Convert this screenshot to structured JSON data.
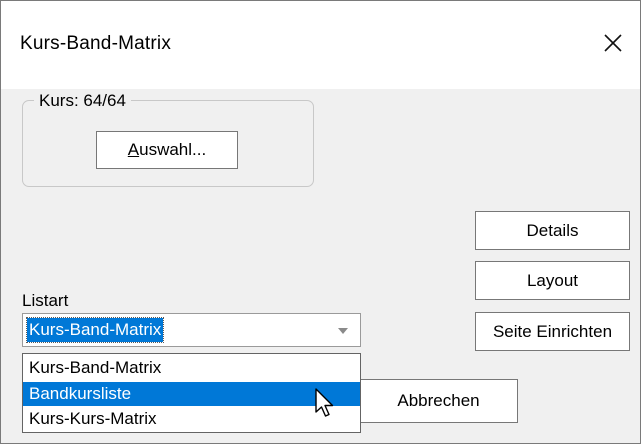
{
  "window": {
    "title": "Kurs-Band-Matrix",
    "close_glyph": "×"
  },
  "group": {
    "label": "Kurs: 64/64",
    "select_button": {
      "mnemonic": "A",
      "rest": "uswahl..."
    }
  },
  "side_buttons": {
    "details": "Details",
    "layout": "Layout",
    "page_setup": "Seite Einrichten"
  },
  "listart": {
    "label": "Listart",
    "selected_value": "Kurs-Band-Matrix",
    "options": [
      {
        "label": "Kurs-Band-Matrix",
        "highlighted": false
      },
      {
        "label": "Bandkursliste",
        "highlighted": true
      },
      {
        "label": "Kurs-Kurs-Matrix",
        "highlighted": false
      }
    ]
  },
  "footer": {
    "cancel_label": "Abbrechen"
  },
  "colors": {
    "selection": "#0078d7",
    "dialog_background": "#f0f0f0",
    "titlebar_background": "#ffffff"
  },
  "icons": {
    "close": "close-icon",
    "dropdown": "chevron-down-icon",
    "cursor": "mouse-pointer-icon"
  }
}
